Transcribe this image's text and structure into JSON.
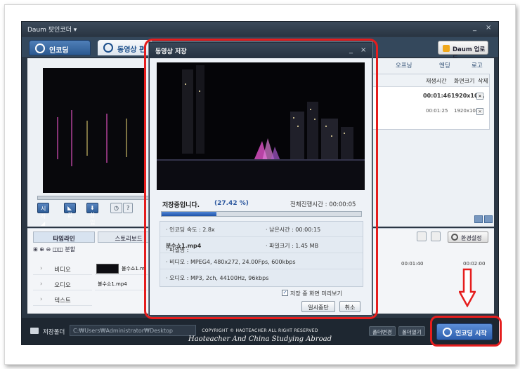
{
  "app": {
    "title": "Daum 팟인코더 ▾",
    "tab_encoding": "인코딩",
    "tab_edit": "동영상 편",
    "daum_upload": "Daum 업로드",
    "side_tabs": [
      "오프닝",
      "엔딩",
      "로고"
    ],
    "file_columns": [
      "재생시간",
      "화면크기",
      "삭제"
    ],
    "files": [
      {
        "duration": "00:01:46",
        "size": "1920x10..."
      },
      {
        "duration": "00:01:25",
        "size": "1920x1080"
      }
    ],
    "controls": {
      "start": "시작◢",
      "end": "◣ 끝",
      "insert": "⬇삽입",
      "help": "?"
    },
    "timeline": {
      "tabs": [
        "타임라인",
        "스토리보드"
      ],
      "tools": "⊞ ⊕ ⊖  ◫◫ 분할",
      "tracks": [
        "비디오",
        "오디오",
        "텍스트"
      ],
      "video_clip": "불수쇼1.m",
      "audio_clip": "불수쇼1.mp4",
      "ruler": [
        "00:01:40",
        "00:02:00"
      ],
      "env_settings": "환경설정"
    },
    "bottom": {
      "save_folder_label": "저장폴더",
      "save_path": "C:₩Users₩Administrator₩Desktop",
      "change_folder": "폴더변경",
      "open_folder": "폴더열기",
      "start_encoding": "인코딩 시작"
    }
  },
  "dialog": {
    "title": "동영상 저장",
    "status": "저장중입니다.",
    "percent": "(27.42 %)",
    "progress": 0.2742,
    "total_time_label": "전체진행시간 :",
    "total_time": "00:00:05",
    "encoding_speed": "· 인코딩 속도 : 2.8x",
    "remaining_time": "· 남은시간 : 00:00:15",
    "filename_label": "· 파일명 : ",
    "filename": "분수쇼1.mp4",
    "filesize": "· 파일크기 : 1.45 MB",
    "video": "· 비디오 : MPEG4, 480x272, 24.00Fps, 600kbps",
    "audio": "· 오디오 : MP3, 2ch, 44100Hz, 96kbps",
    "preview_option": "저장 중 화면 미리보기",
    "pause_button": "일시중단",
    "cancel_button": "취소"
  },
  "watermark": {
    "line1": "COPYRIGHT © HAOTEACHER ALL RIGHT RESERVED",
    "line2": "Haoteacher And China Studying Abroad"
  },
  "colors": {
    "accent_red": "#e51d1d",
    "progress_blue": "#1f52a8",
    "app_bg": "#2b3744"
  }
}
